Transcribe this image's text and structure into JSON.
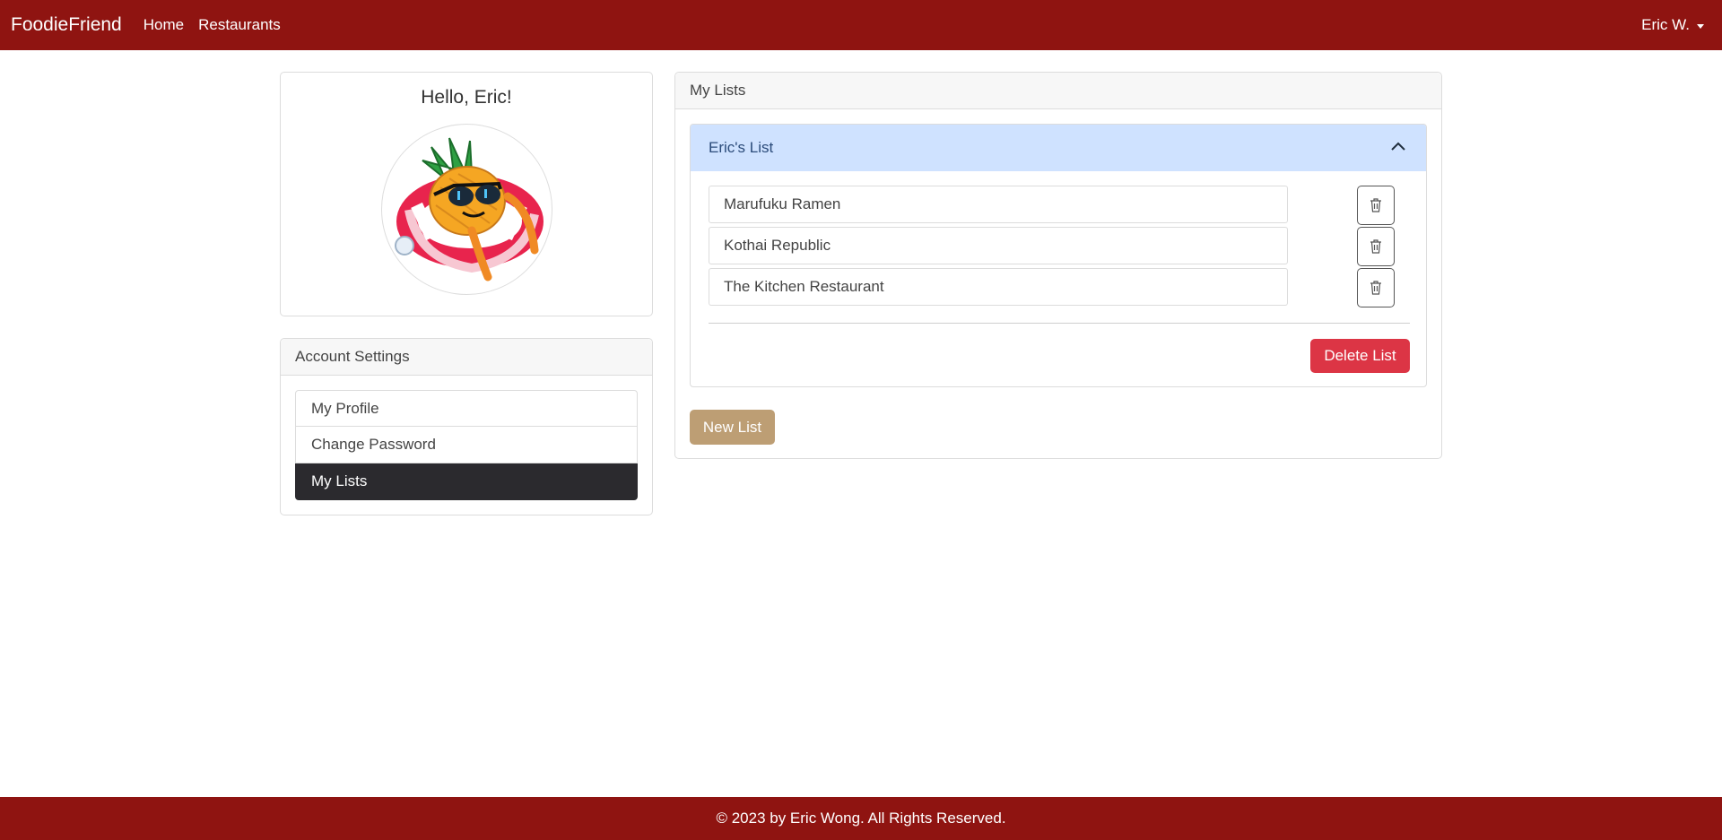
{
  "navbar": {
    "brand": "FoodieFriend",
    "links": [
      "Home",
      "Restaurants"
    ],
    "user": "Eric W."
  },
  "profile": {
    "greeting": "Hello, Eric!",
    "avatar_icon": "pineapple-mascot-avatar"
  },
  "account_settings": {
    "title": "Account Settings",
    "items": [
      "My Profile",
      "Change Password",
      "My Lists"
    ],
    "active": "My Lists"
  },
  "my_lists": {
    "title": "My Lists",
    "lists": [
      {
        "name": "Eric's List",
        "expanded": true,
        "items": [
          "Marufuku Ramen",
          "Kothai Republic",
          "The Kitchen Restaurant"
        ]
      }
    ],
    "delete_label": "Delete List",
    "new_label": "New List"
  },
  "footer": {
    "text": "© 2023 by Eric Wong. All Rights Reserved."
  },
  "colors": {
    "brand_red": "#8f1411",
    "accordion_header": "#cfe2ff",
    "danger": "#dc3545",
    "new_button": "#bd9e74",
    "active_item": "#2b2a2e"
  }
}
